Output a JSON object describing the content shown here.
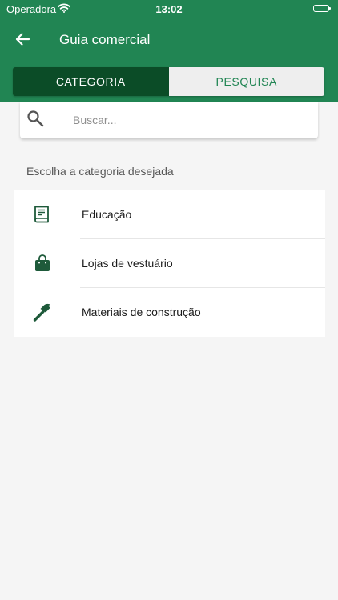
{
  "status_bar": {
    "carrier": "Operadora",
    "time": "13:02"
  },
  "nav": {
    "title": "Guia comercial"
  },
  "tabs": [
    {
      "label": "CATEGORIA",
      "active": true
    },
    {
      "label": "PESQUISA",
      "active": false
    }
  ],
  "search": {
    "placeholder": "Buscar..."
  },
  "section_label": "Escolha a categoria desejada",
  "categories": [
    {
      "label": "Educação",
      "icon": "book-icon"
    },
    {
      "label": "Lojas de vestuário",
      "icon": "shopping-bag-icon"
    },
    {
      "label": "Materiais de construção",
      "icon": "hammer-icon"
    }
  ],
  "colors": {
    "primary": "#218553",
    "primary_dark": "#0b4c27",
    "icon": "#1e5a3a",
    "background": "#f5f5f5"
  }
}
